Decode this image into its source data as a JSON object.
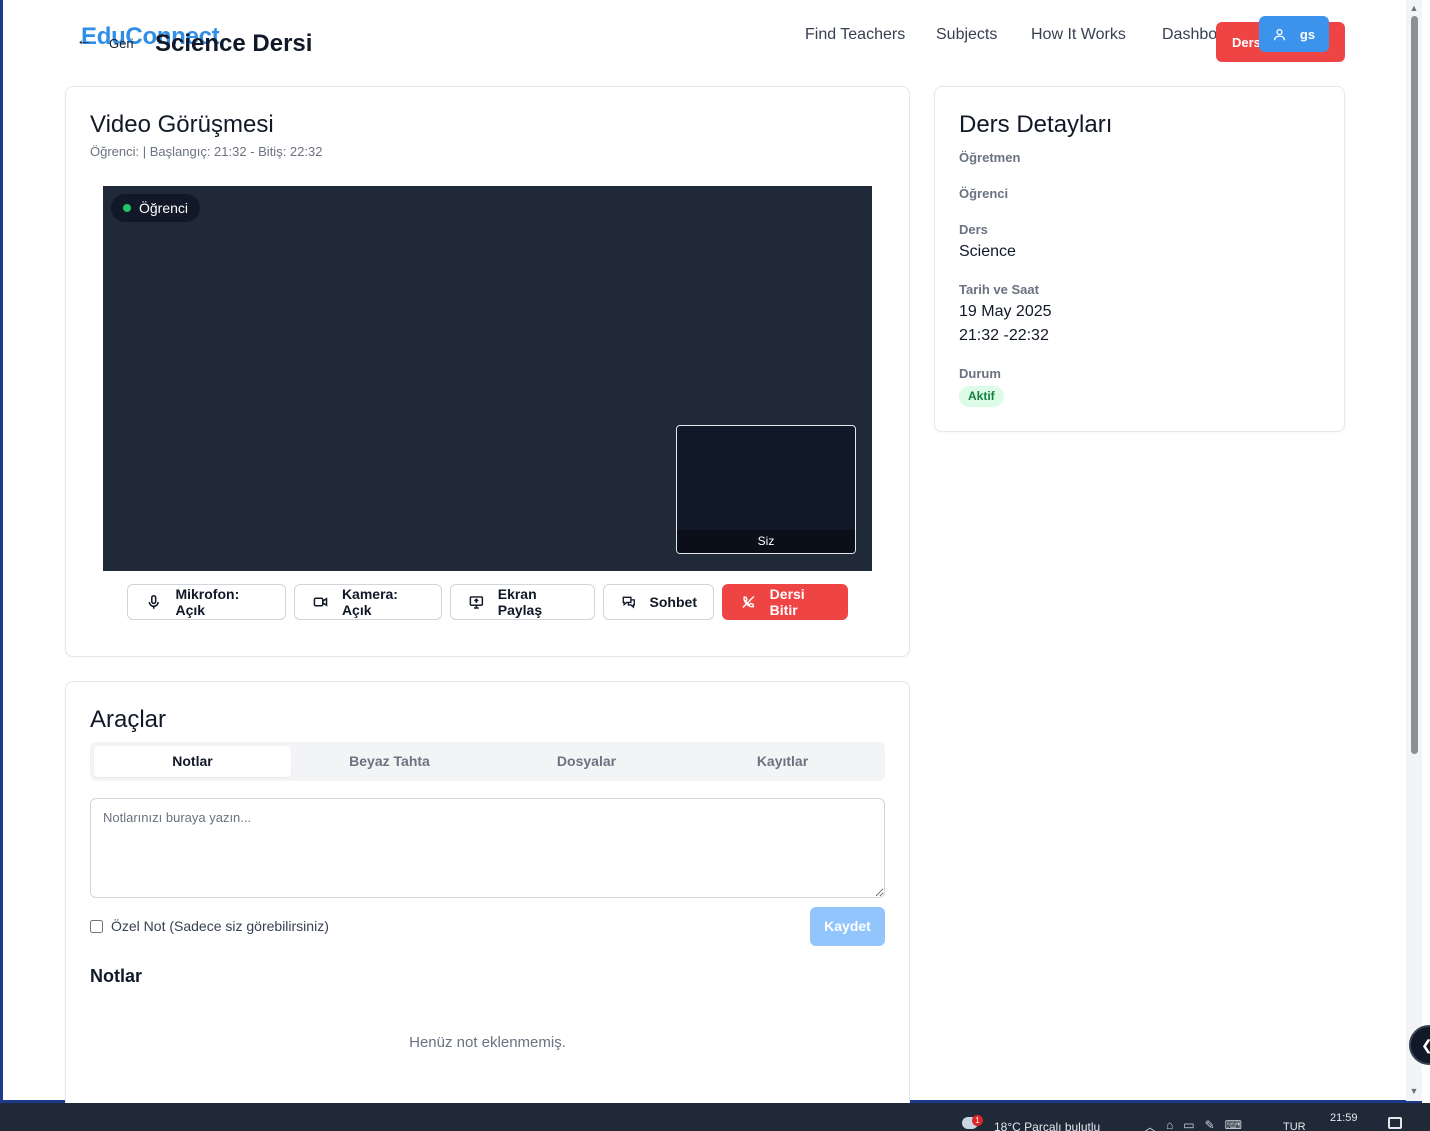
{
  "nav": {
    "logo": "EduConnect",
    "back_label": "Geri",
    "page_title": "Science Dersi",
    "links": [
      "Find Teachers",
      "Subjects",
      "How It Works",
      "Dashboard"
    ],
    "end_button_label": "Ders",
    "user_label": "gs"
  },
  "video_card": {
    "title": "Video Görüşmesi",
    "subtitle": "Öğrenci: | Başlangıç: 21:32 - Bitiş: 22:32",
    "remote_label": "Öğrenci",
    "self_label": "Siz",
    "controls": [
      {
        "label": "Mikrofon: Açık",
        "icon": "microphone-icon"
      },
      {
        "label": "Kamera: Açık",
        "icon": "camera-icon"
      },
      {
        "label": "Ekran Paylaş",
        "icon": "screen-share-icon"
      },
      {
        "label": "Sohbet",
        "icon": "chat-icon"
      },
      {
        "label": "Dersi Bitir",
        "icon": "phone-off-icon"
      }
    ]
  },
  "tools_card": {
    "title": "Araçlar",
    "tabs": [
      "Notlar",
      "Beyaz Tahta",
      "Dosyalar",
      "Kayıtlar"
    ],
    "active_tab": "Notlar",
    "notes_placeholder": "Notlarınızı buraya yazın...",
    "private_label": "Özel Not (Sadece siz görebilirsiniz)",
    "save_label": "Kaydet",
    "notes_heading": "Notlar",
    "empty_text": "Henüz not eklenmemiş."
  },
  "details_card": {
    "title": "Ders Detayları",
    "teacher_label": "Öğretmen",
    "student_label": "Öğrenci",
    "subject_label": "Ders",
    "subject_value": "Science",
    "datetime_label": "Tarih ve Saat",
    "date_value": "19 May 2025",
    "time_value": "21:32 -22:32",
    "status_label": "Durum",
    "status_value": "Aktif"
  },
  "taskbar": {
    "weather_alert": "1",
    "weather": "18°C  Parçalı bulutlu",
    "language": "TUR",
    "time": "21:59"
  },
  "colors": {
    "brand": "#2f8ee8",
    "danger": "#ef4444",
    "video_bg": "#1f2937",
    "status_active": "#15803d"
  }
}
